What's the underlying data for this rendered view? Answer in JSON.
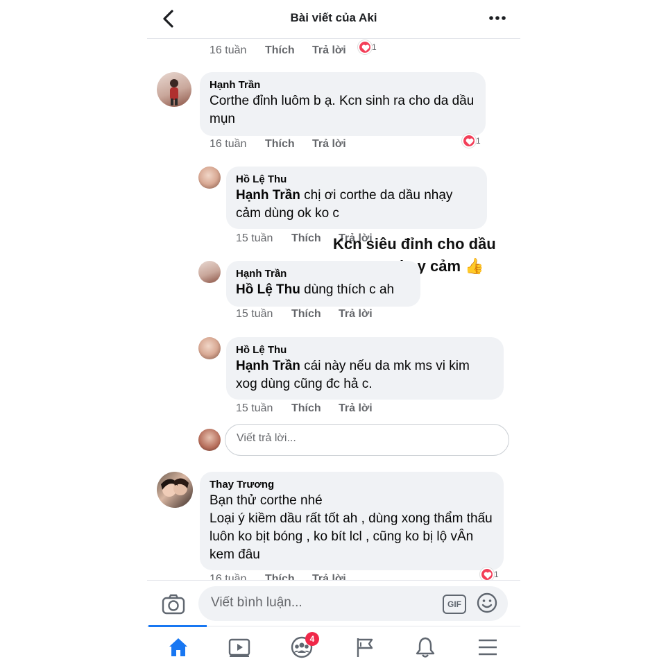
{
  "header": {
    "title": "Bài viết của Aki"
  },
  "top_meta": {
    "time": "16 tuần",
    "like": "Thích",
    "reply": "Trả lời",
    "reaction_count": "1"
  },
  "comments": [
    {
      "author": "Hạnh Trần",
      "text": "Corthe đỉnh luôm b ạ. Kcn sinh ra cho da dầu mụn",
      "time": "16 tuần",
      "like": "Thích",
      "reply": "Trả lời",
      "reaction_count": "1"
    },
    {
      "author": "Hồ Lệ Thu",
      "tag": "Hạnh Trần",
      "text": " chị ơi corthe da dầu nhạy cảm dùng ok ko c",
      "time": "15 tuần",
      "like": "Thích",
      "reply": "Trả lời"
    },
    {
      "author": "Hạnh Trần",
      "tag": "Hồ Lệ Thu",
      "text": " dùng thích c ah",
      "time": "15 tuần",
      "like": "Thích",
      "reply": "Trả lời"
    },
    {
      "author": "Hồ Lệ Thu",
      "tag": "Hạnh Trần",
      "text": " cái này nếu da mk ms vi kim xog dùng cũng đc hả c.",
      "time": "15 tuần",
      "like": "Thích",
      "reply": "Trả lời"
    },
    {
      "author": "Thay Trương",
      "line1": "Bạn thử corthe nhé",
      "line2": "Loại ý kiềm dầu rất tốt ah , dùng xong thẩm thấu luôn ko bịt bóng , ko bít lcl , cũng ko bị lộ vÂn kem đâu",
      "time": "16 tuần",
      "like": "Thích",
      "reply": "Trả lời",
      "reaction_count": "1"
    }
  ],
  "overlay": {
    "line1": "Kcn siêu đỉnh cho dầu",
    "line2": "mụn nhạy cảm 👍"
  },
  "reply_input": {
    "placeholder": "Viết trả lời..."
  },
  "comment_bar": {
    "placeholder": "Viết bình luận...",
    "gif_label": "GIF"
  },
  "tabbar": {
    "groups_badge": "4"
  },
  "colors": {
    "accent": "#1877f2",
    "bubble": "#f0f2f5",
    "heart": "#f33e58",
    "badge": "#f02849"
  },
  "icons": [
    "back-arrow-icon",
    "more-dots-icon",
    "camera-icon",
    "gif-icon",
    "emoji-icon",
    "home-icon",
    "video-icon",
    "groups-icon",
    "flag-icon",
    "bell-icon",
    "menu-icon"
  ]
}
